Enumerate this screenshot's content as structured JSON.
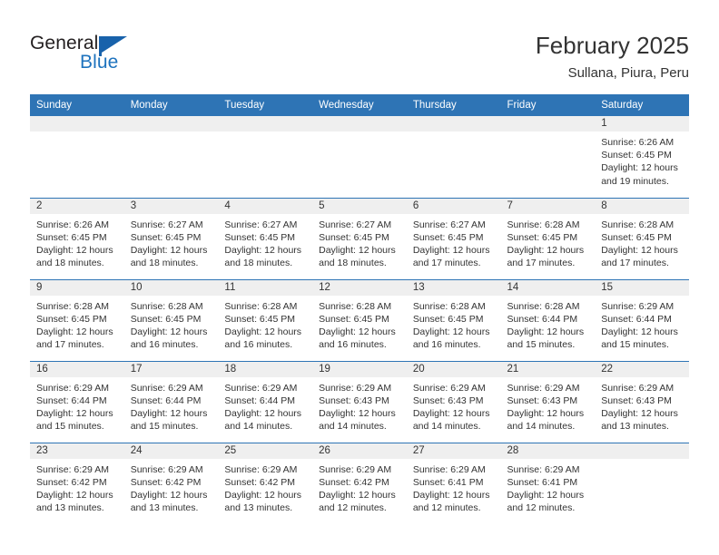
{
  "logo": {
    "word_one": "General",
    "word_two": "Blue",
    "accent_color": "#1e73be",
    "flag_color": "#1862ab"
  },
  "header": {
    "title": "February 2025",
    "subtitle": "Sullana, Piura, Peru"
  },
  "theme": {
    "header_bg": "#2e74b5",
    "daynum_bg": "#efefef",
    "text": "#333333"
  },
  "weekday_headers": [
    "Sunday",
    "Monday",
    "Tuesday",
    "Wednesday",
    "Thursday",
    "Friday",
    "Saturday"
  ],
  "weeks": [
    [
      {
        "day": "",
        "sunrise": "",
        "sunset": "",
        "daylight_a": "",
        "daylight_b": "",
        "empty": true
      },
      {
        "day": "",
        "sunrise": "",
        "sunset": "",
        "daylight_a": "",
        "daylight_b": "",
        "empty": true
      },
      {
        "day": "",
        "sunrise": "",
        "sunset": "",
        "daylight_a": "",
        "daylight_b": "",
        "empty": true
      },
      {
        "day": "",
        "sunrise": "",
        "sunset": "",
        "daylight_a": "",
        "daylight_b": "",
        "empty": true
      },
      {
        "day": "",
        "sunrise": "",
        "sunset": "",
        "daylight_a": "",
        "daylight_b": "",
        "empty": true
      },
      {
        "day": "",
        "sunrise": "",
        "sunset": "",
        "daylight_a": "",
        "daylight_b": "",
        "empty": true
      },
      {
        "day": "1",
        "sunrise": "Sunrise: 6:26 AM",
        "sunset": "Sunset: 6:45 PM",
        "daylight_a": "Daylight: 12 hours",
        "daylight_b": "and 19 minutes.",
        "empty": false
      }
    ],
    [
      {
        "day": "2",
        "sunrise": "Sunrise: 6:26 AM",
        "sunset": "Sunset: 6:45 PM",
        "daylight_a": "Daylight: 12 hours",
        "daylight_b": "and 18 minutes.",
        "empty": false
      },
      {
        "day": "3",
        "sunrise": "Sunrise: 6:27 AM",
        "sunset": "Sunset: 6:45 PM",
        "daylight_a": "Daylight: 12 hours",
        "daylight_b": "and 18 minutes.",
        "empty": false
      },
      {
        "day": "4",
        "sunrise": "Sunrise: 6:27 AM",
        "sunset": "Sunset: 6:45 PM",
        "daylight_a": "Daylight: 12 hours",
        "daylight_b": "and 18 minutes.",
        "empty": false
      },
      {
        "day": "5",
        "sunrise": "Sunrise: 6:27 AM",
        "sunset": "Sunset: 6:45 PM",
        "daylight_a": "Daylight: 12 hours",
        "daylight_b": "and 18 minutes.",
        "empty": false
      },
      {
        "day": "6",
        "sunrise": "Sunrise: 6:27 AM",
        "sunset": "Sunset: 6:45 PM",
        "daylight_a": "Daylight: 12 hours",
        "daylight_b": "and 17 minutes.",
        "empty": false
      },
      {
        "day": "7",
        "sunrise": "Sunrise: 6:28 AM",
        "sunset": "Sunset: 6:45 PM",
        "daylight_a": "Daylight: 12 hours",
        "daylight_b": "and 17 minutes.",
        "empty": false
      },
      {
        "day": "8",
        "sunrise": "Sunrise: 6:28 AM",
        "sunset": "Sunset: 6:45 PM",
        "daylight_a": "Daylight: 12 hours",
        "daylight_b": "and 17 minutes.",
        "empty": false
      }
    ],
    [
      {
        "day": "9",
        "sunrise": "Sunrise: 6:28 AM",
        "sunset": "Sunset: 6:45 PM",
        "daylight_a": "Daylight: 12 hours",
        "daylight_b": "and 17 minutes.",
        "empty": false
      },
      {
        "day": "10",
        "sunrise": "Sunrise: 6:28 AM",
        "sunset": "Sunset: 6:45 PM",
        "daylight_a": "Daylight: 12 hours",
        "daylight_b": "and 16 minutes.",
        "empty": false
      },
      {
        "day": "11",
        "sunrise": "Sunrise: 6:28 AM",
        "sunset": "Sunset: 6:45 PM",
        "daylight_a": "Daylight: 12 hours",
        "daylight_b": "and 16 minutes.",
        "empty": false
      },
      {
        "day": "12",
        "sunrise": "Sunrise: 6:28 AM",
        "sunset": "Sunset: 6:45 PM",
        "daylight_a": "Daylight: 12 hours",
        "daylight_b": "and 16 minutes.",
        "empty": false
      },
      {
        "day": "13",
        "sunrise": "Sunrise: 6:28 AM",
        "sunset": "Sunset: 6:45 PM",
        "daylight_a": "Daylight: 12 hours",
        "daylight_b": "and 16 minutes.",
        "empty": false
      },
      {
        "day": "14",
        "sunrise": "Sunrise: 6:28 AM",
        "sunset": "Sunset: 6:44 PM",
        "daylight_a": "Daylight: 12 hours",
        "daylight_b": "and 15 minutes.",
        "empty": false
      },
      {
        "day": "15",
        "sunrise": "Sunrise: 6:29 AM",
        "sunset": "Sunset: 6:44 PM",
        "daylight_a": "Daylight: 12 hours",
        "daylight_b": "and 15 minutes.",
        "empty": false
      }
    ],
    [
      {
        "day": "16",
        "sunrise": "Sunrise: 6:29 AM",
        "sunset": "Sunset: 6:44 PM",
        "daylight_a": "Daylight: 12 hours",
        "daylight_b": "and 15 minutes.",
        "empty": false
      },
      {
        "day": "17",
        "sunrise": "Sunrise: 6:29 AM",
        "sunset": "Sunset: 6:44 PM",
        "daylight_a": "Daylight: 12 hours",
        "daylight_b": "and 15 minutes.",
        "empty": false
      },
      {
        "day": "18",
        "sunrise": "Sunrise: 6:29 AM",
        "sunset": "Sunset: 6:44 PM",
        "daylight_a": "Daylight: 12 hours",
        "daylight_b": "and 14 minutes.",
        "empty": false
      },
      {
        "day": "19",
        "sunrise": "Sunrise: 6:29 AM",
        "sunset": "Sunset: 6:43 PM",
        "daylight_a": "Daylight: 12 hours",
        "daylight_b": "and 14 minutes.",
        "empty": false
      },
      {
        "day": "20",
        "sunrise": "Sunrise: 6:29 AM",
        "sunset": "Sunset: 6:43 PM",
        "daylight_a": "Daylight: 12 hours",
        "daylight_b": "and 14 minutes.",
        "empty": false
      },
      {
        "day": "21",
        "sunrise": "Sunrise: 6:29 AM",
        "sunset": "Sunset: 6:43 PM",
        "daylight_a": "Daylight: 12 hours",
        "daylight_b": "and 14 minutes.",
        "empty": false
      },
      {
        "day": "22",
        "sunrise": "Sunrise: 6:29 AM",
        "sunset": "Sunset: 6:43 PM",
        "daylight_a": "Daylight: 12 hours",
        "daylight_b": "and 13 minutes.",
        "empty": false
      }
    ],
    [
      {
        "day": "23",
        "sunrise": "Sunrise: 6:29 AM",
        "sunset": "Sunset: 6:42 PM",
        "daylight_a": "Daylight: 12 hours",
        "daylight_b": "and 13 minutes.",
        "empty": false
      },
      {
        "day": "24",
        "sunrise": "Sunrise: 6:29 AM",
        "sunset": "Sunset: 6:42 PM",
        "daylight_a": "Daylight: 12 hours",
        "daylight_b": "and 13 minutes.",
        "empty": false
      },
      {
        "day": "25",
        "sunrise": "Sunrise: 6:29 AM",
        "sunset": "Sunset: 6:42 PM",
        "daylight_a": "Daylight: 12 hours",
        "daylight_b": "and 13 minutes.",
        "empty": false
      },
      {
        "day": "26",
        "sunrise": "Sunrise: 6:29 AM",
        "sunset": "Sunset: 6:42 PM",
        "daylight_a": "Daylight: 12 hours",
        "daylight_b": "and 12 minutes.",
        "empty": false
      },
      {
        "day": "27",
        "sunrise": "Sunrise: 6:29 AM",
        "sunset": "Sunset: 6:41 PM",
        "daylight_a": "Daylight: 12 hours",
        "daylight_b": "and 12 minutes.",
        "empty": false
      },
      {
        "day": "28",
        "sunrise": "Sunrise: 6:29 AM",
        "sunset": "Sunset: 6:41 PM",
        "daylight_a": "Daylight: 12 hours",
        "daylight_b": "and 12 minutes.",
        "empty": false
      },
      {
        "day": "",
        "sunrise": "",
        "sunset": "",
        "daylight_a": "",
        "daylight_b": "",
        "empty": true
      }
    ]
  ]
}
